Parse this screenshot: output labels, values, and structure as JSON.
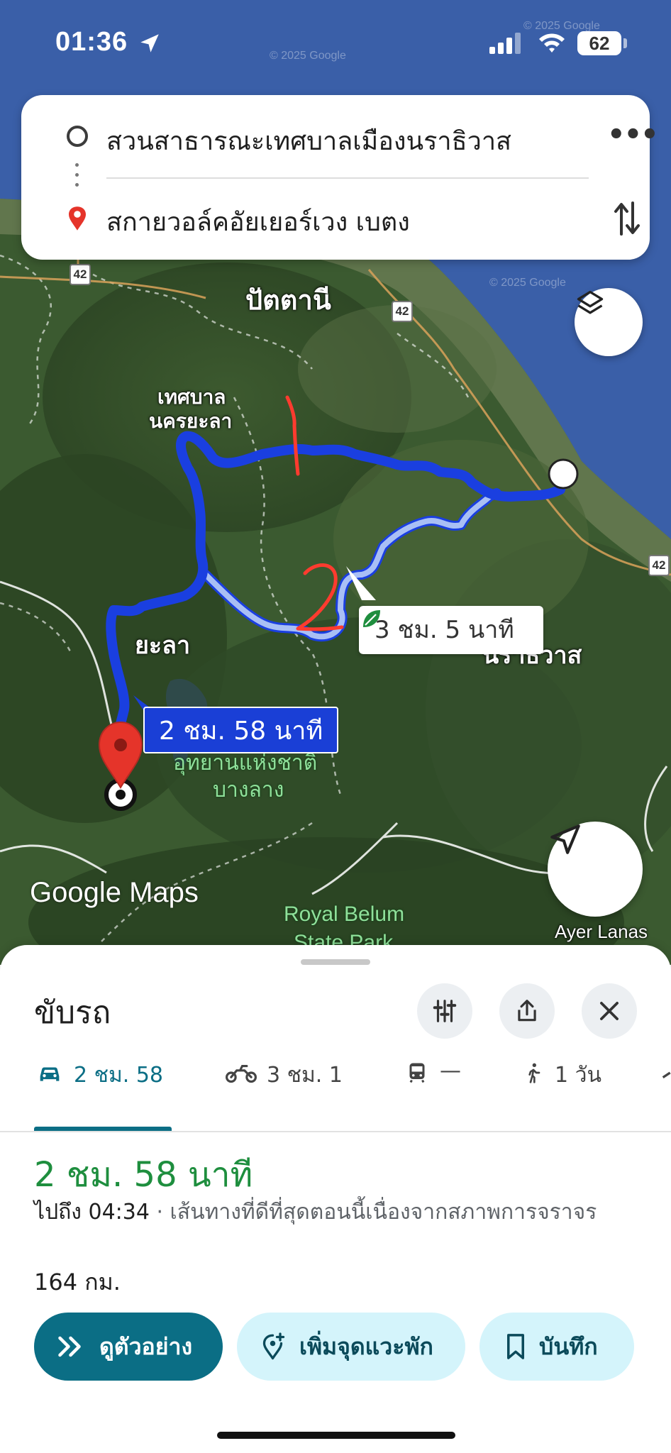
{
  "status_bar": {
    "time": "01:36",
    "battery": "62"
  },
  "route": {
    "origin": "สวนสาธารณะเทศบาลเมืองนราธิวาส",
    "destination": "สกายวอล์คอัยเยอร์เวง เบตง"
  },
  "map": {
    "labels": {
      "pattani": "ปัตตานี",
      "yala_municipality_1": "เทศบาล",
      "yala_municipality_2": "นครยะลา",
      "yala": "ยะลา",
      "bang_lang_1": "อุทยานแห่งชาติ",
      "bang_lang_2": "บางลาง",
      "royal_belum_1": "Royal Belum",
      "royal_belum_2": "State Park",
      "narathiwat": "นราธิวาส",
      "ayer_lanas": "Ayer Lanas"
    },
    "road_shield": "42",
    "logo": "Google Maps",
    "copyright": "© 2025 Google",
    "handwritten": {
      "route_1": "1",
      "route_2": "2"
    },
    "route_main_time": "2 ชม. 58 นาที",
    "route_alt_time": "3 ชม. 5 นาที",
    "colors": {
      "route_main": "#1a3fe0",
      "route_alt": "#a9bff5",
      "water": "#3a5fa8"
    }
  },
  "sheet": {
    "title": "ขับรถ",
    "modes": [
      {
        "icon": "car-icon",
        "label": "2 ชม. 58"
      },
      {
        "icon": "motorcycle-icon",
        "label": "3 ชม. 1"
      },
      {
        "icon": "transit-icon",
        "label": "—"
      },
      {
        "icon": "walk-icon",
        "label": "1 วัน"
      }
    ],
    "duration": "2 ชม. 58 นาที",
    "arrival": "ไปถึง 04:34",
    "reason": " · เส้นทางที่ดีที่สุดตอนนี้เนื่องจากสภาพการจราจร",
    "distance": "164 กม.",
    "actions": {
      "preview": "ดูตัวอย่าง",
      "add_stop": "เพิ่มจุดแวะพัก",
      "save": "บันทึก"
    }
  }
}
